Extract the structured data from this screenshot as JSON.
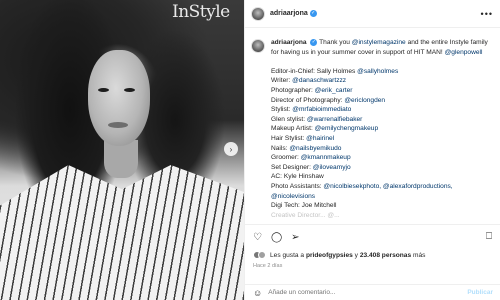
{
  "photo": {
    "brand": "InStyle",
    "next_arrow": "›"
  },
  "header": {
    "username": "adriaarjona",
    "verified_mark": "✓",
    "more": "•••"
  },
  "caption": {
    "username": "adriaarjona",
    "intro_1": "Thank you ",
    "mention_1": "@instylemagazine",
    "intro_2": " and the entire Instyle family for having us in your summer cover in support of HIT MAN! ",
    "mention_2": "@glenpowell",
    "credits": [
      {
        "role": "Editor-in-Chief: Sally Holmes ",
        "handle": "@sallyholmes"
      },
      {
        "role": "Writer: ",
        "handle": "@danaschwartzzz"
      },
      {
        "role": "Photographer: ",
        "handle": "@erik_carter"
      },
      {
        "role": "Director of Photography: ",
        "handle": "@ericlongden"
      },
      {
        "role": "Stylist: ",
        "handle": "@mrfabioimmediato"
      },
      {
        "role": "Glen stylist: ",
        "handle": "@warrenalfiebaker"
      },
      {
        "role": "Makeup Artist: ",
        "handle": "@emilychengmakeup"
      },
      {
        "role": "Hair Stylist: ",
        "handle": "@hairinel"
      },
      {
        "role": "Nails: ",
        "handle": "@nailsbyemikudo"
      },
      {
        "role": "Groomer: ",
        "handle": "@kmannmakeup"
      },
      {
        "role": "Set Designer: ",
        "handle": "@iloveamyjo"
      },
      {
        "role": "AC: Kyle Hinshaw",
        "handle": ""
      },
      {
        "role": "Photo Assistants: ",
        "handle": "@nicolbiesekphoto, @alexafordproductions, @nicolevisions"
      },
      {
        "role": "Digi Tech: Joe Mitchell",
        "handle": ""
      }
    ],
    "cut_line": "Creative Director... @..."
  },
  "actions": {
    "like_icon": "heart-icon",
    "comment_icon": "comment-icon",
    "share_icon": "share-icon",
    "save_icon": "bookmark-icon",
    "likes_prefix": "Les gusta a ",
    "likes_user": "prideofgypsies",
    "likes_mid": " y ",
    "likes_count": "23.408 personas",
    "likes_suffix": " más",
    "time": "Hace 2 días"
  },
  "comment": {
    "emoji": "☺",
    "placeholder": "Añade un comentario...",
    "publish": "Publicar"
  },
  "colors": {
    "link": "#00376b",
    "verified": "#3897f0",
    "publish": "#b2dffc"
  }
}
